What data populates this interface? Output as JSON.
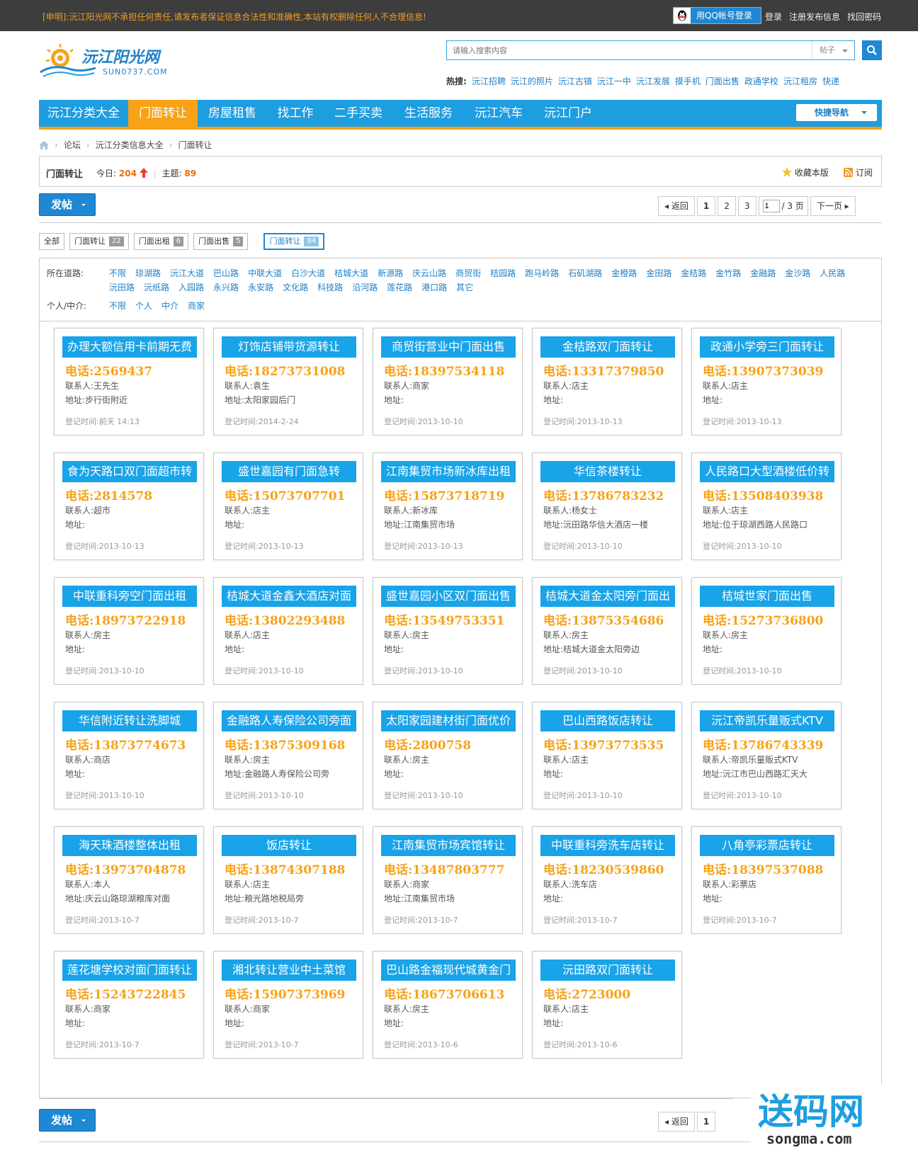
{
  "topbar": {
    "notice": "[申明]:沅江阳光网不承担任何责任,请发布者保证信息合法性和准确性,本站有权删除任何人不合理信息!",
    "qq_login": "用QQ帐号登录",
    "links": [
      "登录",
      "注册发布信息",
      "找回密码"
    ]
  },
  "logo": {
    "name": "沅江阳光网",
    "domain": "SUN0737.COM"
  },
  "search": {
    "placeholder": "请输入搜索内容",
    "type": "帖子"
  },
  "hot": {
    "label": "热搜:",
    "items": [
      "沅江招聘",
      "沅江的照片",
      "沅江古镇",
      "沅江一中",
      "沅江发展",
      "摸手机",
      "门面出售",
      "政通学校",
      "沅江租房",
      "快递"
    ]
  },
  "nav": {
    "items": [
      "沅江分类大全",
      "门面转让",
      "房屋租售",
      "找工作",
      "二手买卖",
      "生活服务",
      "沅江汽车",
      "沅江门户"
    ],
    "active_index": 1,
    "quick": "快捷导航"
  },
  "breadcrumb": [
    "论坛",
    "沅江分类信息大全",
    "门面转让"
  ],
  "forum": {
    "title": "门面转让",
    "today_label": "今日:",
    "today": "204",
    "topics_label": "主题:",
    "topics": "89",
    "favorite": "收藏本版",
    "subscribe": "订阅"
  },
  "post_button": "发帖",
  "pager": {
    "back": "返回",
    "pages": [
      "1",
      "2",
      "3"
    ],
    "input": "1",
    "total": "/ 3 页",
    "next": "下一页"
  },
  "tabs": [
    {
      "label": "全部",
      "count": ""
    },
    {
      "label": "门面转让",
      "count": "22"
    },
    {
      "label": "门面出租",
      "count": "6"
    },
    {
      "label": "门面出售",
      "count": "5"
    },
    {
      "label": "门面转让",
      "count": "84"
    }
  ],
  "filter": {
    "road_label": "所在道路:",
    "roads": [
      "不限",
      "琼湖路",
      "沅江大道",
      "巴山路",
      "中联大道",
      "白沙大道",
      "桔城大道",
      "新源路",
      "庆云山路",
      "商贸街",
      "桔园路",
      "跑马岭路",
      "石矶湖路",
      "金橙路",
      "金田路",
      "金桔路",
      "金竹路",
      "金融路",
      "金沙路",
      "人民路",
      "沅田路",
      "沅纸路",
      "入园路",
      "永兴路",
      "永安路",
      "文化路",
      "科技路",
      "沿河路",
      "莲花路",
      "港口路",
      "其它"
    ],
    "who_label": "个人/中介:",
    "who": [
      "不限",
      "个人",
      "中介",
      "商家"
    ]
  },
  "listings": [
    {
      "title": "办理大额信用卡前期无费",
      "phone": "电话:2569437",
      "contact": "联系人:王先生",
      "address": "地址:步行街附近",
      "date": "登记时间:前天 14:13"
    },
    {
      "title": "灯饰店铺带货源转让",
      "phone": "电话:18273731008",
      "contact": "联系人:袁生",
      "address": "地址:太阳家园后门",
      "date": "登记时间:2014-2-24"
    },
    {
      "title": "商贸街营业中门面出售",
      "phone": "电话:18397534118",
      "contact": "联系人:商家",
      "address": "地址:",
      "date": "登记时间:2013-10-10"
    },
    {
      "title": "金桔路双门面转让",
      "phone": "电话:13317379850",
      "contact": "联系人:店主",
      "address": "地址:",
      "date": "登记时间:2013-10-13"
    },
    {
      "title": "政通小学旁三门面转让",
      "phone": "电话:13907373039",
      "contact": "联系人:店主",
      "address": "地址:",
      "date": "登记时间:2013-10-13"
    },
    {
      "title": "食为天路口双门面超市转",
      "phone": "电话:2814578",
      "contact": "联系人:超市",
      "address": "地址:",
      "date": "登记时间:2013-10-13"
    },
    {
      "title": "盛世嘉园有门面急转",
      "phone": "电话:15073707701",
      "contact": "联系人:店主",
      "address": "地址:",
      "date": "登记时间:2013-10-13"
    },
    {
      "title": "江南集贸市场新冰库出租",
      "phone": "电话:15873718719",
      "contact": "联系人:新冰库",
      "address": "地址:江南集贸市场",
      "date": "登记时间:2013-10-13"
    },
    {
      "title": "华信茶楼转让",
      "phone": "电话:13786783232",
      "contact": "联系人:杨女士",
      "address": "地址:沅田路华信大酒店一楼",
      "date": "登记时间:2013-10-10"
    },
    {
      "title": "人民路口大型酒楼低价转",
      "phone": "电话:13508403938",
      "contact": "联系人:店主",
      "address": "地址:位于琼湖西路人民路口",
      "date": "登记时间:2013-10-10"
    },
    {
      "title": "中联重科旁空门面出租",
      "phone": "电话:18973722918",
      "contact": "联系人:房主",
      "address": "地址:",
      "date": "登记时间:2013-10-10"
    },
    {
      "title": "桔城大道金鑫大酒店对面",
      "phone": "电话:13802293488",
      "contact": "联系人:店主",
      "address": "地址:",
      "date": "登记时间:2013-10-10"
    },
    {
      "title": "盛世嘉园小区双门面出售",
      "phone": "电话:13549753351",
      "contact": "联系人:房主",
      "address": "地址:",
      "date": "登记时间:2013-10-10"
    },
    {
      "title": "桔城大道金太阳旁门面出",
      "phone": "电话:13875354686",
      "contact": "联系人:房主",
      "address": "地址:桔城大道金太阳旁边",
      "date": "登记时间:2013-10-10"
    },
    {
      "title": "桔城世家门面出售",
      "phone": "电话:15273736800",
      "contact": "联系人:房主",
      "address": "地址:",
      "date": "登记时间:2013-10-10"
    },
    {
      "title": "华信附近转让洗脚城",
      "phone": "电话:13873774673",
      "contact": "联系人:商店",
      "address": "地址:",
      "date": "登记时间:2013-10-10"
    },
    {
      "title": "金融路人寿保险公司旁面",
      "phone": "电话:13875309168",
      "contact": "联系人:房主",
      "address": "地址:金融路人寿保险公司旁",
      "date": "登记时间:2013-10-10"
    },
    {
      "title": "太阳家园建材街门面优价",
      "phone": "电话:2800758",
      "contact": "联系人:房主",
      "address": "地址:",
      "date": "登记时间:2013-10-10"
    },
    {
      "title": "巴山西路饭店转让",
      "phone": "电话:13973773535",
      "contact": "联系人:店主",
      "address": "地址:",
      "date": "登记时间:2013-10-10"
    },
    {
      "title": "沅江帝凯乐量贩式KTV",
      "phone": "电话:13786743339",
      "contact": "联系人:帝凯乐量贩式KTV",
      "address": "地址:沅江市巴山西路汇天大",
      "date": "登记时间:2013-10-10"
    },
    {
      "title": "海天珠酒楼整体出租",
      "phone": "电话:13973704878",
      "contact": "联系人:本人",
      "address": "地址:庆云山路琼湖粮库对面",
      "date": "登记时间:2013-10-7"
    },
    {
      "title": "饭店转让",
      "phone": "电话:13874307188",
      "contact": "联系人:店主",
      "address": "地址:粮光路地税局旁",
      "date": "登记时间:2013-10-7"
    },
    {
      "title": "江南集贸市场宾馆转让",
      "phone": "电话:13487803777",
      "contact": "联系人:商家",
      "address": "地址:江南集贸市场",
      "date": "登记时间:2013-10-7"
    },
    {
      "title": "中联重科旁洗车店转让",
      "phone": "电话:18230539860",
      "contact": "联系人:洗车店",
      "address": "地址:",
      "date": "登记时间:2013-10-7"
    },
    {
      "title": "八角亭彩票店转让",
      "phone": "电话:18397537088",
      "contact": "联系人:彩票店",
      "address": "地址:",
      "date": "登记时间:2013-10-7"
    },
    {
      "title": "莲花塘学校对面门面转让",
      "phone": "电话:15243722845",
      "contact": "联系人:商家",
      "address": "地址:",
      "date": "登记时间:2013-10-7"
    },
    {
      "title": "湘北转让营业中土菜馆",
      "phone": "电话:15907373969",
      "contact": "联系人:商家",
      "address": "地址:",
      "date": "登记时间:2013-10-7"
    },
    {
      "title": "巴山路金福现代城黄金门",
      "phone": "电话:18673706613",
      "contact": "联系人:房主",
      "address": "地址:",
      "date": "登记时间:2013-10-6"
    },
    {
      "title": "沅田路双门面转让",
      "phone": "电话:2723000",
      "contact": "联系人:店主",
      "address": "地址:",
      "date": "登记时间:2013-10-6"
    }
  ],
  "pager_bottom": {
    "back": "返回",
    "page": "1"
  },
  "watermark": {
    "text": "送码网",
    "domain": "songma.com"
  },
  "colors": {
    "accent": "#1e9de0",
    "orange": "#f7a217",
    "card_title": "#19a3e8"
  }
}
